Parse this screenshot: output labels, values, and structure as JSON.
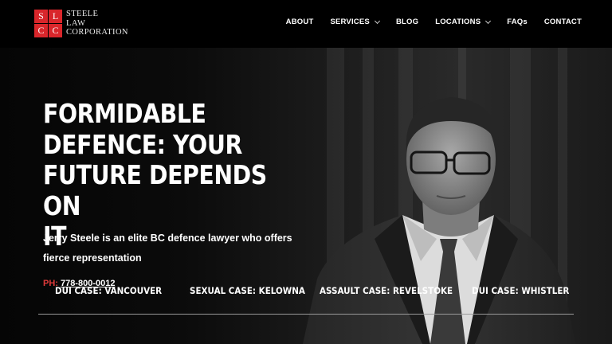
{
  "brand": {
    "logo_letters": [
      "S",
      "L",
      "C",
      "C"
    ],
    "name_lines": [
      "STEELE",
      "LAW",
      "CORPORATION"
    ],
    "accent_color": "#d9262b"
  },
  "nav": {
    "items": [
      {
        "label": "ABOUT",
        "has_dropdown": false
      },
      {
        "label": "SERVICES",
        "has_dropdown": true
      },
      {
        "label": "BLOG",
        "has_dropdown": false
      },
      {
        "label": "LOCATIONS",
        "has_dropdown": true
      },
      {
        "label": "FAQs",
        "has_dropdown": false
      },
      {
        "label": "CONTACT",
        "has_dropdown": false
      }
    ]
  },
  "hero": {
    "headline": "FORMIDABLE\nDEFENCE: YOUR\nFUTURE DEPENDS ON\nIT",
    "subtext": "Jerry Steele is an elite BC defence lawyer who offers fierce representation",
    "phone_label": "PH:",
    "phone_number": "778-800-0012",
    "phone_label_color": "#e03a3a"
  },
  "cases": [
    {
      "label": "DUI CASE: VANCOUVER"
    },
    {
      "label": "SEXUAL CASE: KELOWNA"
    },
    {
      "label": "ASSAULT CASE: REVELSTOKE"
    },
    {
      "label": "DUI CASE: WHISTLER"
    }
  ]
}
